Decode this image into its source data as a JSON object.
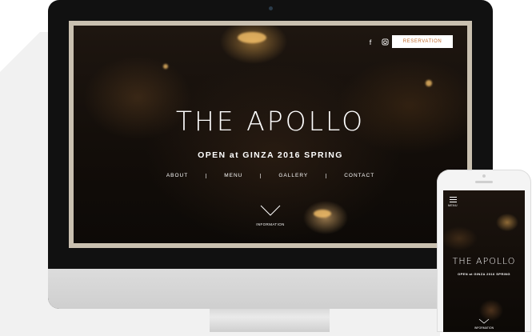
{
  "desktop": {
    "social_icons": [
      "facebook-icon",
      "instagram-icon"
    ],
    "reservation_label": "RESERVATION",
    "title": "THE APOLLO",
    "tagline": "OPEN at GINZA 2016 SPRING",
    "nav": [
      "ABOUT",
      "MENU",
      "GALLERY",
      "CONTACT"
    ],
    "info_label": "INFORMATION"
  },
  "mobile": {
    "menu_label": "MENU",
    "title": "THE APOLLO",
    "tagline": "OPEN at GINZA 2016 SPRING",
    "info_label": "INFORMATION"
  },
  "colors": {
    "accent": "#c06a2b",
    "screen_frame": "#c9c0b0"
  }
}
